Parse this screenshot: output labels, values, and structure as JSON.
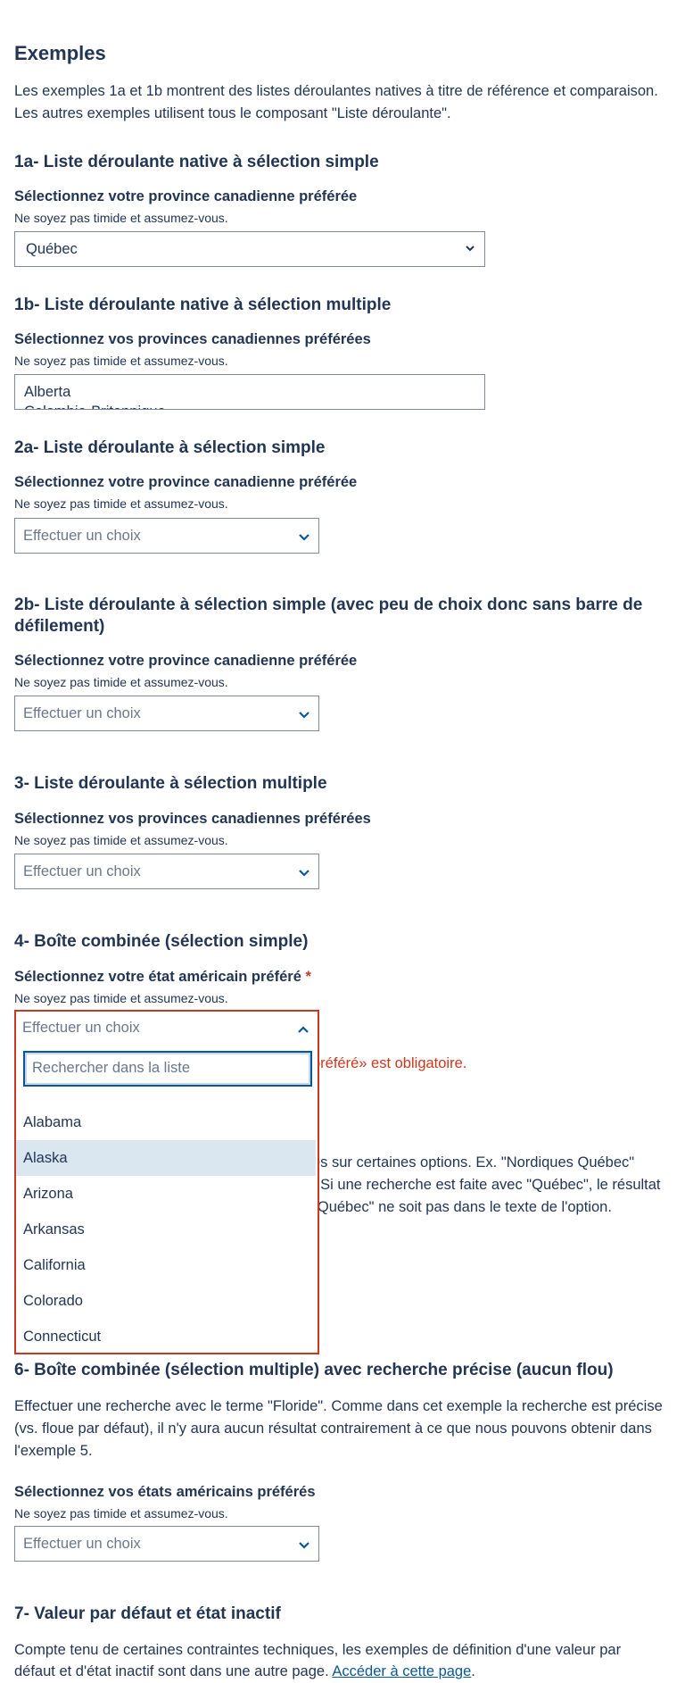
{
  "heading": "Exemples",
  "intro": {
    "line1": "Les exemples 1a et 1b montrent des listes déroulantes natives à titre de référence et comparaison.",
    "line2": "Les autres exemples utilisent tous le composant \"Liste déroulante\"."
  },
  "common": {
    "hint": "Ne soyez pas timide et assumez-vous.",
    "label_province": "Sélectionnez votre province canadienne préférée",
    "label_provinces": "Sélectionnez vos provinces canadiennes préférées",
    "placeholder": "Effectuer un choix"
  },
  "ex1a": {
    "title": "1a- Liste déroulante native à sélection simple",
    "value": "Québec"
  },
  "ex1b": {
    "title": "1b- Liste déroulante native à sélection multiple",
    "options": [
      "Alberta",
      "Colombie-Britannique"
    ]
  },
  "ex2a": {
    "title": "2a- Liste déroulante à sélection simple"
  },
  "ex2b": {
    "title_line1": "2b- Liste déroulante à sélection simple (avec peu de choix donc sans barre de",
    "title_line2": "défilement)"
  },
  "ex3": {
    "title": "3- Liste déroulante à sélection multiple"
  },
  "ex4": {
    "title": "4- Boîte combinée (sélection simple)",
    "label": "Sélectionnez votre état américain préféré",
    "required_marker": "*",
    "search_placeholder": "Rechercher dans la liste",
    "error_visible": "préféré» est obligatoire.",
    "options": [
      "Alabama",
      "Alaska",
      "Arizona",
      "Arkansas",
      "California",
      "Colorado",
      "Connecticut"
    ],
    "highlighted": "Alaska"
  },
  "ex5_partial": {
    "line1": "és sur certaines options. Ex. \"Nordiques Québec\"",
    "line2": ". Si une recherche est faite avec \"Québec\", le résultat",
    "line3": "\"Québec\" ne soit pas dans le texte de l'option."
  },
  "ex6": {
    "title": "6- Boîte combinée (sélection multiple) avec recherche précise (aucun flou)",
    "desc_line1": "Effectuer une recherche avec le terme \"Floride\". Comme dans cet exemple la recherche est précise",
    "desc_line2": "(vs. floue par défaut), il n'y aura aucun résultat contrairement à ce que nous pouvons obtenir dans",
    "desc_line3": "l'exemple 5.",
    "label": "Sélectionnez vos états américains préférés"
  },
  "ex7": {
    "title": "7- Valeur par défaut et état inactif",
    "desc_line1": "Compte tenu de certaines contraintes techniques, les exemples de définition d'une valeur par",
    "desc_line2_prefix": "défaut et d'état inactif sont dans une autre page. ",
    "link": "Accéder à cette page",
    "desc_line2_suffix": "."
  }
}
